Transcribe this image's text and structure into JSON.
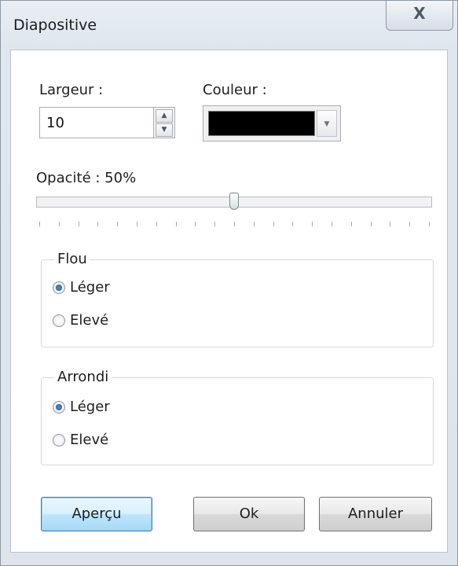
{
  "window": {
    "title": "Diapositive",
    "close_glyph": "X"
  },
  "width": {
    "label": "Largeur :",
    "value": "10"
  },
  "color": {
    "label": "Couleur :",
    "value": "#000000"
  },
  "opacity": {
    "label": "Opacité : 50%",
    "value_percent": 50,
    "tick_count": 21
  },
  "blur": {
    "legend": "Flou",
    "options": [
      {
        "label": "Léger",
        "checked": true
      },
      {
        "label": "Elevé",
        "checked": false
      }
    ]
  },
  "rounding": {
    "legend": "Arrondi",
    "options": [
      {
        "label": "Léger",
        "checked": true
      },
      {
        "label": "Elevé",
        "checked": false
      }
    ]
  },
  "buttons": {
    "preview": "Aperçu",
    "ok": "Ok",
    "cancel": "Annuler"
  },
  "colors": {
    "accent_button_border": "#3c7fb1",
    "swatch": "#000000"
  }
}
